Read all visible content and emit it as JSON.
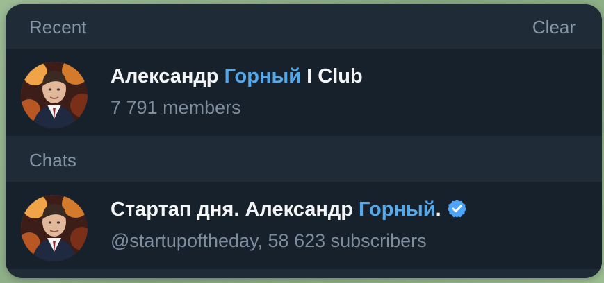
{
  "sections": [
    {
      "title": "Recent",
      "action": "Clear",
      "items": [
        {
          "name_parts": [
            "Александр ",
            "Горный",
            " I Club"
          ],
          "subtitle": "7 791 members",
          "verified": false
        }
      ]
    },
    {
      "title": "Chats",
      "items": [
        {
          "name_parts": [
            "Стартап дня. Александр ",
            "Горный",
            "."
          ],
          "subtitle": "@startupoftheday, 58 623 subscribers",
          "verified": true
        }
      ]
    }
  ],
  "colors": {
    "panel": "#1f2c38",
    "row": "#17212b",
    "header_text": "#8796a6",
    "name_text": "#f3f5f7",
    "highlight": "#54a9eb",
    "subtitle_text": "#7f8e9d",
    "verified": "#4ea4f6"
  },
  "icons": {
    "avatar": "portrait-avatar",
    "verified": "verified-badge-icon"
  }
}
